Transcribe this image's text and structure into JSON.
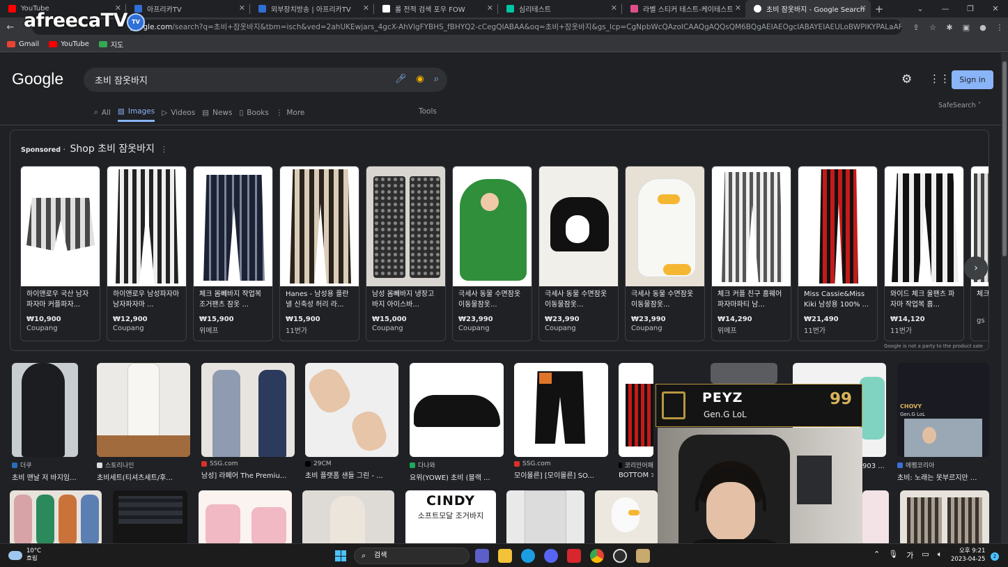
{
  "browser": {
    "tabs": [
      {
        "title": "YouTube",
        "color": "#ff0000"
      },
      {
        "title": "아프리카TV",
        "color": "#2f6fd6"
      },
      {
        "title": "외부장치방송 | 아프리카TV",
        "color": "#2f6fd6"
      },
      {
        "title": "롤 전적 검색 포우 FOW",
        "color": "#ffffff"
      },
      {
        "title": "심리테스트",
        "color": "#00c4a7"
      },
      {
        "title": "라벨 스티커 테스트-케이테스트",
        "color": "#e04f8b"
      },
      {
        "title": "초비 잠옷바지 - Google Search",
        "color": "#ffffff"
      }
    ],
    "new_tab_label": "+",
    "url_host": "google.com",
    "url_rest": "/search?q=초비+잠옷바지&tbm=isch&ved=2ahUKEwjars_4gcX-AhVlgFYBHS_fBHYQ2-cCegQIABAA&oq=초비+잠옷바지&gs_lcp=CgNpbWcQAzoICAAQgAQQsQM6BQgAEIAEOgcIABAYEIAEULoBWPIKYPALaAFwAHgBgAFiiAGcCZIBAjE0m...",
    "bookmarks": [
      {
        "label": "Gmail",
        "color": "#ea4335"
      },
      {
        "label": "YouTube",
        "color": "#ff0000"
      },
      {
        "label": "지도",
        "color": "#34a853"
      }
    ]
  },
  "watermark": {
    "text": "afreecaTV",
    "badge": "TV"
  },
  "google": {
    "logo": "Google",
    "query": "초비 잠옷바지",
    "sign_in": "Sign in",
    "tabs": [
      {
        "label": "All",
        "icon": "search-icon"
      },
      {
        "label": "Images",
        "icon": "image-icon"
      },
      {
        "label": "Videos",
        "icon": "video-icon"
      },
      {
        "label": "News",
        "icon": "news-icon"
      },
      {
        "label": "Books",
        "icon": "book-icon"
      },
      {
        "label": "More",
        "icon": "more-icon"
      }
    ],
    "tools": "Tools",
    "safesearch": "SafeSearch ˅"
  },
  "shopping": {
    "sponsored": "Sponsored",
    "title": "Shop 초비 잠옷바지",
    "disclaimer": "Google is not a party to the product sale",
    "cards": [
      {
        "title": "하이앤로우 국산 남자파자마 커플파자...",
        "price": "₩10,900",
        "store": "Coupang"
      },
      {
        "title": "하이앤로우 남성파자마 남자파자마 ...",
        "price": "₩12,900",
        "store": "Coupang"
      },
      {
        "title": "체크 몸빼바지 작업복 조거팬츠 잠옷 ...",
        "price": "₩15,900",
        "store": "위메프"
      },
      {
        "title": "Hanes - 남성용 플란넬 신축성 허리 라...",
        "price": "₩15,900",
        "store": "11번가"
      },
      {
        "title": "남성 몸빼바지 냉장고 바지 아이스바...",
        "price": "₩15,000",
        "store": "Coupang"
      },
      {
        "title": "극세사 동물 수면잠옷 이동물잠옷...",
        "price": "₩23,990",
        "store": "Coupang"
      },
      {
        "title": "극세사 동물 수면잠옷 이동물잠옷...",
        "price": "₩23,990",
        "store": "Coupang"
      },
      {
        "title": "극세사 동물 수면잠옷 이동물잠옷...",
        "price": "₩23,990",
        "store": "Coupang"
      },
      {
        "title": "체크 커플 친구 홈웨어 파자마파티 남...",
        "price": "₩14,290",
        "store": "위메프"
      },
      {
        "title": "Miss Cassie&Miss Kiki 남성용 100% ...",
        "price": "₩21,490",
        "store": "11번가"
      },
      {
        "title": "와이드 체크 울팬츠 파자마 작업복 홈...",
        "price": "₩14,120",
        "store": "11번가"
      },
      {
        "title": "체크 어...",
        "price": "",
        "store": "gs"
      }
    ]
  },
  "images": [
    {
      "source": "더쿠",
      "caption": "초비 맨날 저 바지임...",
      "color": "#2a6db5"
    },
    {
      "source": "스토리나인",
      "caption": "초비세트(티셔츠세트/후...",
      "color": "#dddddd"
    },
    {
      "source": "SSG.com",
      "caption": "남성] 라페어 The Premiu...",
      "color": "#d9302c"
    },
    {
      "source": "29CM",
      "caption": "초비 플랫폼 샌들 그린 - ...",
      "color": "#000000"
    },
    {
      "source": "다나와",
      "caption": "요위(YOWE) 초비 (블랙 ...",
      "color": "#1fa85a"
    },
    {
      "source": "SSG.com",
      "caption": "모이몰른] [모이몰른] SO...",
      "color": "#d9302c"
    },
    {
      "source": "코리안어패",
      "caption": "BOTTOM >...",
      "color": "#000000"
    },
    {
      "source": "",
      "caption": "",
      "color": "#888888"
    },
    {
      "source": "",
      "caption": "903 ...",
      "color": "#888888"
    },
    {
      "source": "에펨코리아",
      "caption": "초비: 노래는 못부르지만 ...",
      "color": "#3a6fd8"
    }
  ],
  "grid_third_row": {
    "cindy_title": "CINDY",
    "cindy_sub": "소프트모달 조거바지"
  },
  "overlay": {
    "name": "PEYZ",
    "team": "Gen.G LoL",
    "number": "99",
    "inner_name": "CHOVY",
    "inner_team": "Gen.G LoL"
  },
  "taskbar": {
    "temp": "10°C",
    "weather": "흐림",
    "search": "검색",
    "time": "오후 9:21",
    "date": "2023-04-25",
    "ime": "가",
    "notif_count": "2"
  }
}
